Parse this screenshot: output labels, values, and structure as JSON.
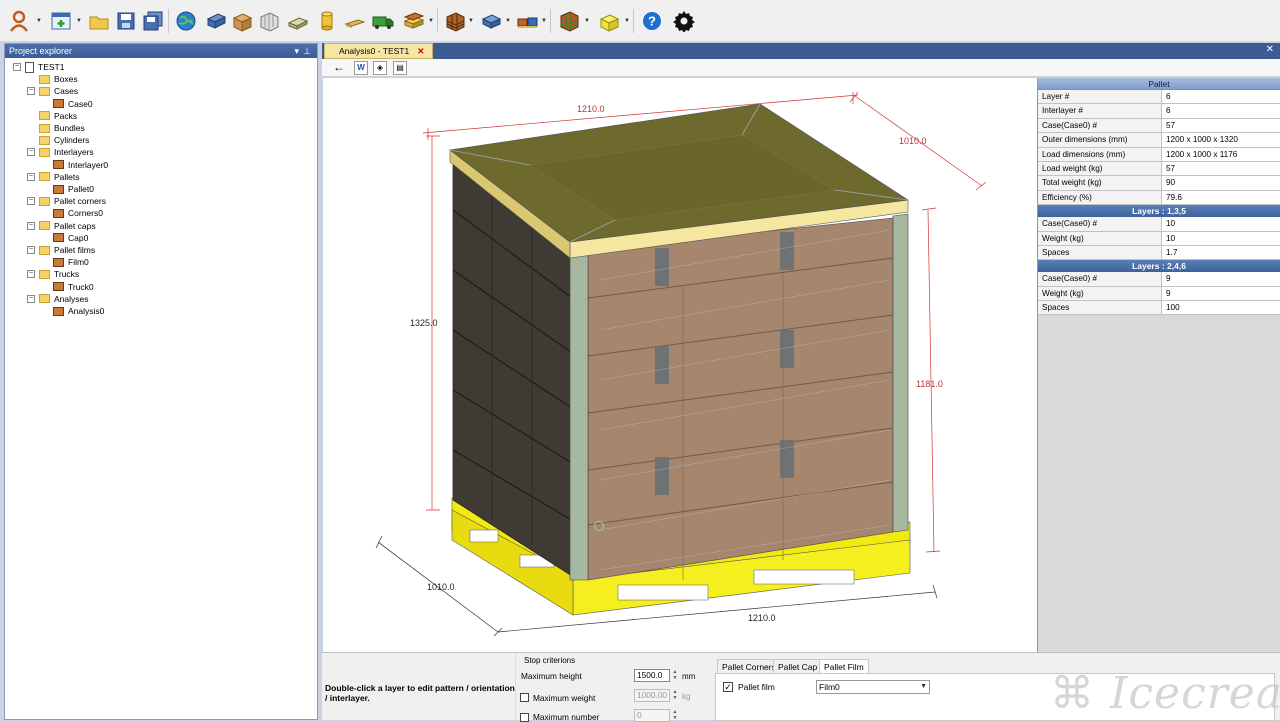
{
  "toolbar": {
    "buttons": [
      "user-icon",
      "new-document-icon",
      "open-folder-icon",
      "save-icon",
      "save-all-icon",
      "globe-icon",
      "box-icon",
      "case-icon",
      "pack-icon",
      "bundle-icon",
      "cylinder-icon",
      "interlayer-icon",
      "truck-icon",
      "pallet-icon",
      "analysis-icon",
      "stacking-icon",
      "case-analysis-icon",
      "pallet-cap-icon",
      "help-icon",
      "settings-icon"
    ]
  },
  "explorer": {
    "title": "Project explorer",
    "root": "TEST1",
    "items": [
      {
        "label": "Boxes",
        "level": 1
      },
      {
        "label": "Cases",
        "level": 1
      },
      {
        "label": "Case0",
        "level": 2
      },
      {
        "label": "Packs",
        "level": 1
      },
      {
        "label": "Bundles",
        "level": 1
      },
      {
        "label": "Cylinders",
        "level": 1
      },
      {
        "label": "Interlayers",
        "level": 1
      },
      {
        "label": "Interlayer0",
        "level": 2
      },
      {
        "label": "Pallets",
        "level": 1
      },
      {
        "label": "Pallet0",
        "level": 2
      },
      {
        "label": "Pallet corners",
        "level": 1
      },
      {
        "label": "Corners0",
        "level": 2
      },
      {
        "label": "Pallet caps",
        "level": 1
      },
      {
        "label": "Cap0",
        "level": 2
      },
      {
        "label": "Pallet films",
        "level": 1
      },
      {
        "label": "Film0",
        "level": 2
      },
      {
        "label": "Trucks",
        "level": 1
      },
      {
        "label": "Truck0",
        "level": 2
      },
      {
        "label": "Analyses",
        "level": 1
      },
      {
        "label": "Analysis0",
        "level": 2
      }
    ]
  },
  "document_tab": {
    "label": "Analysis0 - TEST1",
    "close": "✕"
  },
  "viewport": {
    "dimensions": {
      "top_length": "1210.0",
      "top_width": "1010.0",
      "height_left": "1325.0",
      "height_right": "1181.0",
      "bottom_width": "1010.0",
      "bottom_length": "1210.0"
    }
  },
  "properties": {
    "header": "Pallet",
    "pallet_rows": [
      {
        "key": "Layer #",
        "value": "6"
      },
      {
        "key": "Interlayer #",
        "value": "6"
      },
      {
        "key": "Case(Case0) #",
        "value": "57"
      },
      {
        "key": "Outer dimensions (mm)",
        "value": "1200 x 1000 x 1320"
      },
      {
        "key": "Load dimensions (mm)",
        "value": "1200 x 1000 x 1176"
      },
      {
        "key": "Load weight (kg)",
        "value": "57"
      },
      {
        "key": "Total weight (kg)",
        "value": "90"
      },
      {
        "key": "Efficiency (%)",
        "value": "79.6"
      }
    ],
    "section1": "Layers : 1,3,5",
    "section1_rows": [
      {
        "key": "Case(Case0) #",
        "value": "10"
      },
      {
        "key": "Weight (kg)",
        "value": "10"
      },
      {
        "key": "Spaces",
        "value": "1.7"
      }
    ],
    "section2": "Layers : 2,4,6",
    "section2_rows": [
      {
        "key": "Case(Case0) #",
        "value": "9"
      },
      {
        "key": "Weight (kg)",
        "value": "9"
      },
      {
        "key": "Spaces",
        "value": "100"
      }
    ]
  },
  "bottom": {
    "hint": "Double-click a layer to edit pattern / orientation / interlayer.",
    "stop_title": "Stop criterions",
    "max_height_label": "Maximum height",
    "max_height_value": "1500.0",
    "max_height_unit": "mm",
    "max_weight_label": "Maximum weight",
    "max_weight_value": "1000.00",
    "max_weight_unit": "kg",
    "max_number_label": "Maximum number",
    "max_number_value": "0",
    "tabs": [
      "Pallet Corners",
      "Pallet Cap",
      "Pallet Film"
    ],
    "pallet_film_label": "Pallet film",
    "pallet_film_checked": "✓",
    "film_select": "Film0"
  },
  "watermark": "Icecream"
}
